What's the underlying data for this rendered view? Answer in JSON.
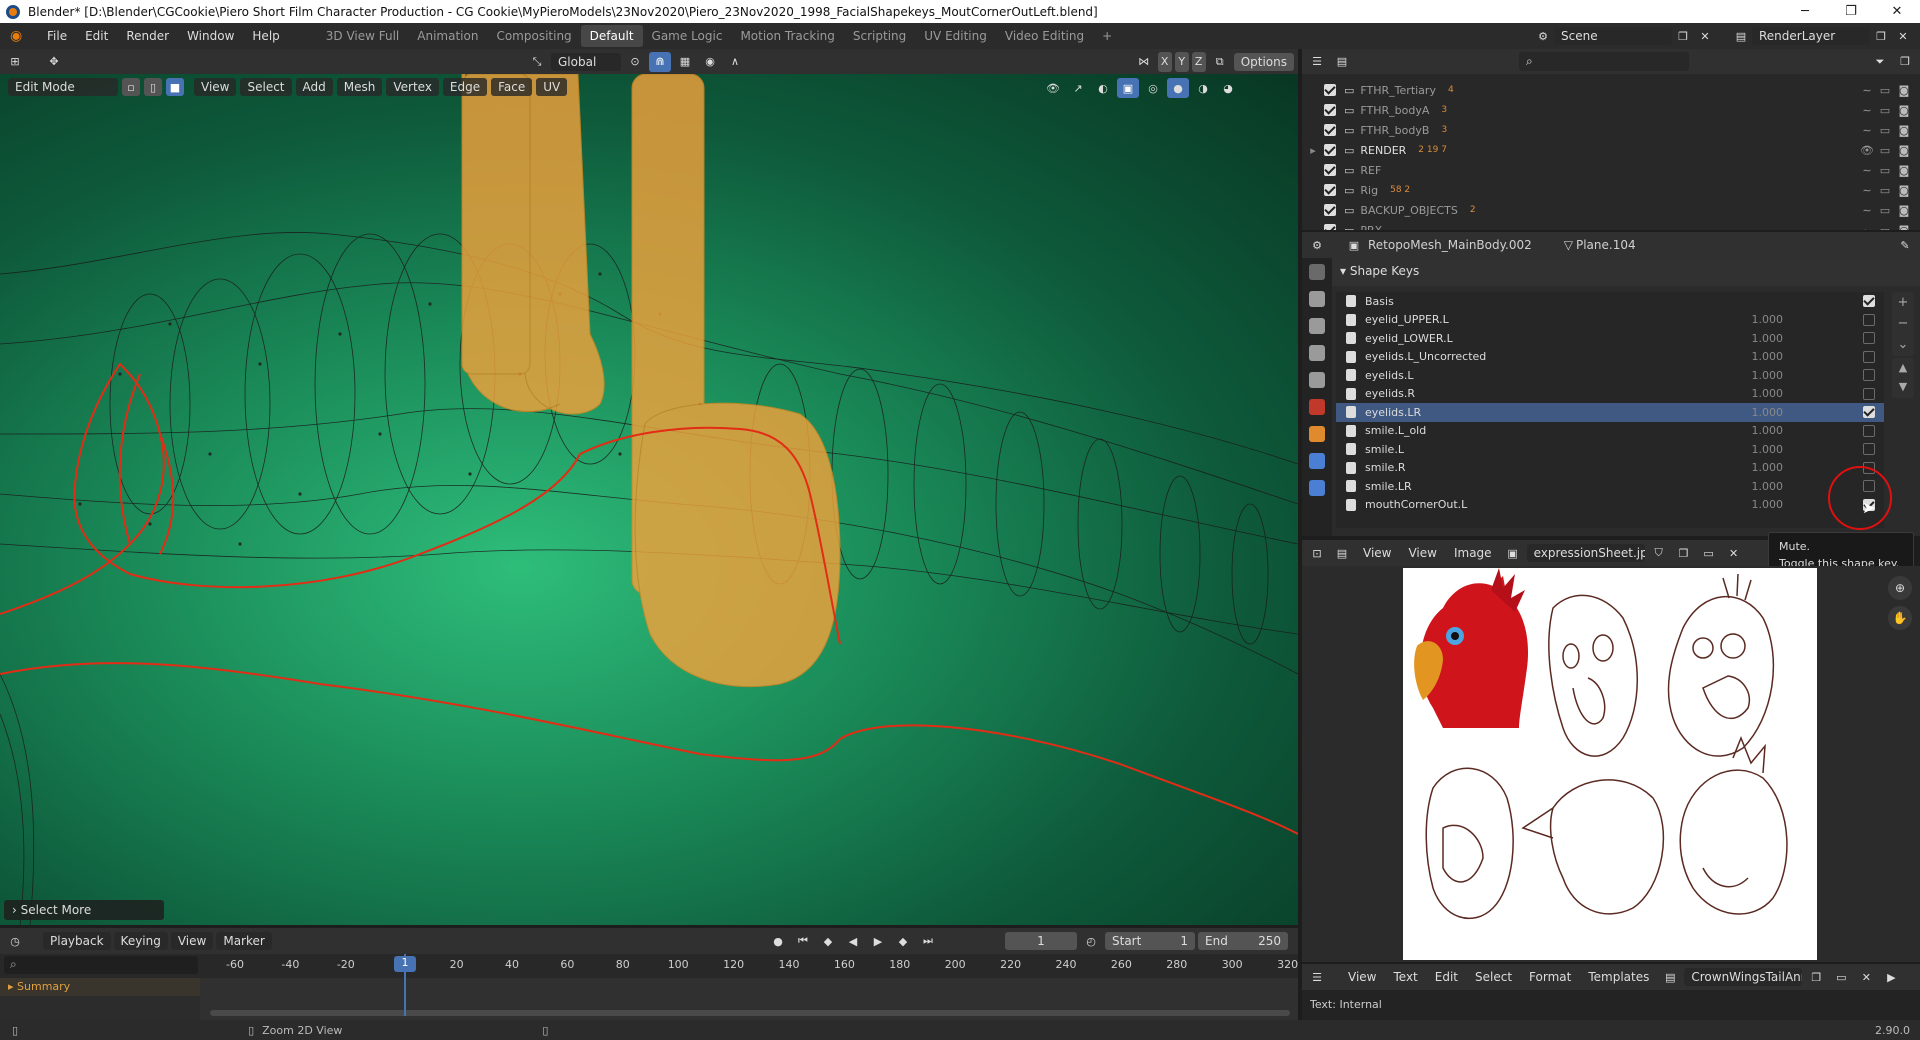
{
  "window": {
    "title": "Blender* [D:\\Blender\\CGCookie\\Piero Short Film Character Production - CG Cookie\\MyPieroModels\\23Nov2020\\Piero_23Nov2020_1998_FacialShapekeys_MoutCornerOutLeft.blend]"
  },
  "menu": {
    "items": [
      "File",
      "Edit",
      "Render",
      "Window",
      "Help"
    ]
  },
  "workspaces": [
    "3D View Full",
    "Animation",
    "Compositing",
    "Default",
    "Game Logic",
    "Motion Tracking",
    "Scripting",
    "UV Editing",
    "Video Editing"
  ],
  "active_workspace": "Default",
  "scene": {
    "name": "Scene",
    "layer": "RenderLayer"
  },
  "viewport": {
    "transform_orientation": "Global",
    "options": "Options",
    "mode": "Edit Mode",
    "menus": [
      "View",
      "Select",
      "Add",
      "Mesh",
      "Vertex",
      "Edge",
      "Face",
      "UV"
    ],
    "axes": [
      "X",
      "Y",
      "Z"
    ],
    "operator_panel": "Select More"
  },
  "outliner": {
    "rows": [
      {
        "name": "FTHR_Tertiary",
        "badge": "4"
      },
      {
        "name": "FTHR_bodyA",
        "badge": "3"
      },
      {
        "name": "FTHR_bodyB",
        "badge": "3"
      },
      {
        "name": "RENDER",
        "badge": "2 19 7"
      },
      {
        "name": "REF",
        "badge": ""
      },
      {
        "name": "Rig",
        "badge": "58 2"
      },
      {
        "name": "BACKUP_OBJECTS",
        "badge": "2"
      },
      {
        "name": "PRX",
        "badge": ""
      }
    ]
  },
  "properties": {
    "object": "RetopoMesh_MainBody.002",
    "data": "Plane.104",
    "panel": "Shape Keys",
    "shape_keys": [
      {
        "name": "Basis",
        "value": "",
        "checked": true,
        "selected": false
      },
      {
        "name": "eyelid_UPPER.L",
        "value": "1.000",
        "checked": false,
        "selected": false
      },
      {
        "name": "eyelid_LOWER.L",
        "value": "1.000",
        "checked": false,
        "selected": false
      },
      {
        "name": "eyelids.L_Uncorrected",
        "value": "1.000",
        "checked": false,
        "selected": false
      },
      {
        "name": "eyelids.L",
        "value": "1.000",
        "checked": false,
        "selected": false
      },
      {
        "name": "eyelids.R",
        "value": "1.000",
        "checked": false,
        "selected": false
      },
      {
        "name": "eyelids.LR",
        "value": "1.000",
        "checked": true,
        "selected": true
      },
      {
        "name": "smile.L_old",
        "value": "1.000",
        "checked": false,
        "selected": false
      },
      {
        "name": "smile.L",
        "value": "1.000",
        "checked": false,
        "selected": false
      },
      {
        "name": "smile.R",
        "value": "1.000",
        "checked": false,
        "selected": false
      },
      {
        "name": "smile.LR",
        "value": "1.000",
        "checked": false,
        "selected": false
      },
      {
        "name": "mouthCornerOut.L",
        "value": "1.000",
        "checked": true,
        "selected": false
      }
    ],
    "tooltip_title": "Mute.",
    "tooltip_body": "Toggle this shape key."
  },
  "image_editor": {
    "menus": [
      "View",
      "View",
      "Image"
    ],
    "image": "expressionSheet.jpg"
  },
  "text_editor": {
    "menus": [
      "View",
      "Text",
      "Edit",
      "Select",
      "Format",
      "Templates"
    ],
    "file": "CrownWingsTailAnn...",
    "status": "Text: Internal"
  },
  "timeline": {
    "menus": [
      "Playback",
      "Keying",
      "View",
      "Marker"
    ],
    "current_frame": "1",
    "start_label": "Start",
    "start": "1",
    "end_label": "End",
    "end": "250",
    "ruler": [
      "-60",
      "-40",
      "-20",
      "1",
      "20",
      "40",
      "60",
      "80",
      "100",
      "120",
      "140",
      "160",
      "180",
      "200",
      "220",
      "240",
      "260",
      "280",
      "300",
      "320"
    ],
    "summary": "Summary"
  },
  "statusbar": {
    "hint": "Zoom 2D View",
    "version": "2.90.0"
  },
  "colors": {
    "accent": "#4772b3",
    "selected_row": "#3f5983",
    "header": "#303030",
    "panel": "#2b2b2b"
  }
}
